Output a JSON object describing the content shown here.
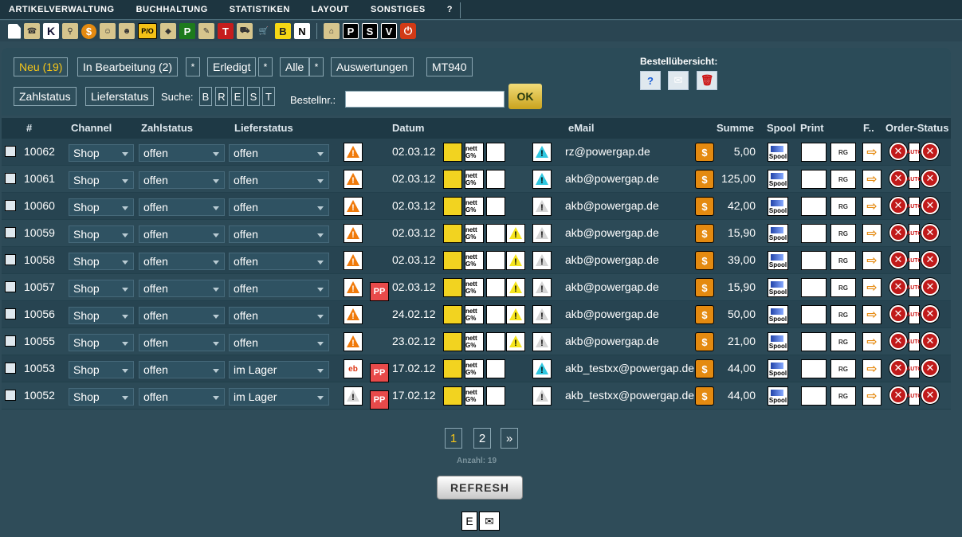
{
  "menu": [
    "Artikelverwaltung",
    "Buchhaltung",
    "Statistiken",
    "Layout",
    "Sonstiges",
    "?"
  ],
  "toolbar_letters": {
    "k": "K",
    "dollar": "$",
    "p": "P",
    "t": "T",
    "b": "B",
    "n": "N",
    "letter_p": "P",
    "letter_s": "S",
    "letter_v": "V",
    "pio": "P/O"
  },
  "filters": {
    "neu": "Neu (19)",
    "bearbeitung": "In Bearbeitung (2)",
    "erledigt": "Erledigt",
    "alle": "Alle",
    "auswertungen": "Auswertungen",
    "mt940": "MT940",
    "star": "*",
    "zahlstatus": "Zahlstatus",
    "lieferstatus": "Lieferstatus",
    "suche": "Suche:",
    "suche_letters": [
      "B",
      "R",
      "E",
      "S",
      "T"
    ],
    "bestellnr": "Bestellnr.:",
    "ok": "OK",
    "bestelluebersicht": "Bestellübersicht:"
  },
  "columns": {
    "id": "#",
    "channel": "Channel",
    "zahlstatus": "Zahlstatus",
    "lieferstatus": "Lieferstatus",
    "datum": "Datum",
    "email": "eMail",
    "summe": "Summe",
    "spool": "Spool",
    "print": "Print",
    "f": "F..",
    "order_status": "Order-Status"
  },
  "icon_labels": {
    "warn": "!",
    "pp": "PP",
    "netto": "nett G%",
    "spool": "Spool",
    "print": "RG",
    "auto": "AUTO",
    "x": "✕",
    "arrow": "⇨",
    "dollar": "$",
    "ebay": "eb"
  },
  "orders": [
    {
      "id": "10062",
      "channel": "Shop",
      "zahl": "offen",
      "liefer": "offen",
      "datum": "02.03.12",
      "email": "rz@powergap.de",
      "summe": "5,00",
      "pp": false,
      "ebay": false,
      "extra_warn": false,
      "mail_warn": "cyan",
      "first_warn": "orange"
    },
    {
      "id": "10061",
      "channel": "Shop",
      "zahl": "offen",
      "liefer": "offen",
      "datum": "02.03.12",
      "email": "akb@powergap.de",
      "summe": "125,00",
      "pp": false,
      "ebay": false,
      "extra_warn": false,
      "mail_warn": "cyan",
      "first_warn": "orange"
    },
    {
      "id": "10060",
      "channel": "Shop",
      "zahl": "offen",
      "liefer": "offen",
      "datum": "02.03.12",
      "email": "akb@powergap.de",
      "summe": "42,00",
      "pp": false,
      "ebay": false,
      "extra_warn": false,
      "mail_warn": "grey",
      "first_warn": "orange"
    },
    {
      "id": "10059",
      "channel": "Shop",
      "zahl": "offen",
      "liefer": "offen",
      "datum": "02.03.12",
      "email": "akb@powergap.de",
      "summe": "15,90",
      "pp": false,
      "ebay": false,
      "extra_warn": true,
      "mail_warn": "grey",
      "first_warn": "orange"
    },
    {
      "id": "10058",
      "channel": "Shop",
      "zahl": "offen",
      "liefer": "offen",
      "datum": "02.03.12",
      "email": "akb@powergap.de",
      "summe": "39,00",
      "pp": false,
      "ebay": false,
      "extra_warn": true,
      "mail_warn": "grey",
      "first_warn": "orange"
    },
    {
      "id": "10057",
      "channel": "Shop",
      "zahl": "offen",
      "liefer": "offen",
      "datum": "02.03.12",
      "email": "akb@powergap.de",
      "summe": "15,90",
      "pp": true,
      "ebay": false,
      "extra_warn": true,
      "mail_warn": "grey",
      "first_warn": "orange"
    },
    {
      "id": "10056",
      "channel": "Shop",
      "zahl": "offen",
      "liefer": "offen",
      "datum": "24.02.12",
      "email": "akb@powergap.de",
      "summe": "50,00",
      "pp": false,
      "ebay": false,
      "extra_warn": true,
      "mail_warn": "grey",
      "first_warn": "orange"
    },
    {
      "id": "10055",
      "channel": "Shop",
      "zahl": "offen",
      "liefer": "offen",
      "datum": "23.02.12",
      "email": "akb@powergap.de",
      "summe": "21,00",
      "pp": false,
      "ebay": false,
      "extra_warn": true,
      "mail_warn": "grey",
      "first_warn": "orange"
    },
    {
      "id": "10053",
      "channel": "Shop",
      "zahl": "offen",
      "liefer": "im Lager",
      "datum": "17.02.12",
      "email": "akb_testxx@powergap.de",
      "summe": "44,00",
      "pp": true,
      "ebay": true,
      "extra_warn": false,
      "mail_warn": "cyan",
      "first_warn": "ebay"
    },
    {
      "id": "10052",
      "channel": "Shop",
      "zahl": "offen",
      "liefer": "im Lager",
      "datum": "17.02.12",
      "email": "akb_testxx@powergap.de",
      "summe": "44,00",
      "pp": true,
      "ebay": false,
      "extra_warn": false,
      "mail_warn": "grey",
      "first_warn": "grey"
    }
  ],
  "pager": {
    "p1": "1",
    "p2": "2",
    "next": "»",
    "anzahl": "Anzahl: 19"
  },
  "refresh": "REFRESH",
  "colors": {
    "bg": "#2f4c59",
    "accent": "#f5c518",
    "header": "#1e3945"
  }
}
